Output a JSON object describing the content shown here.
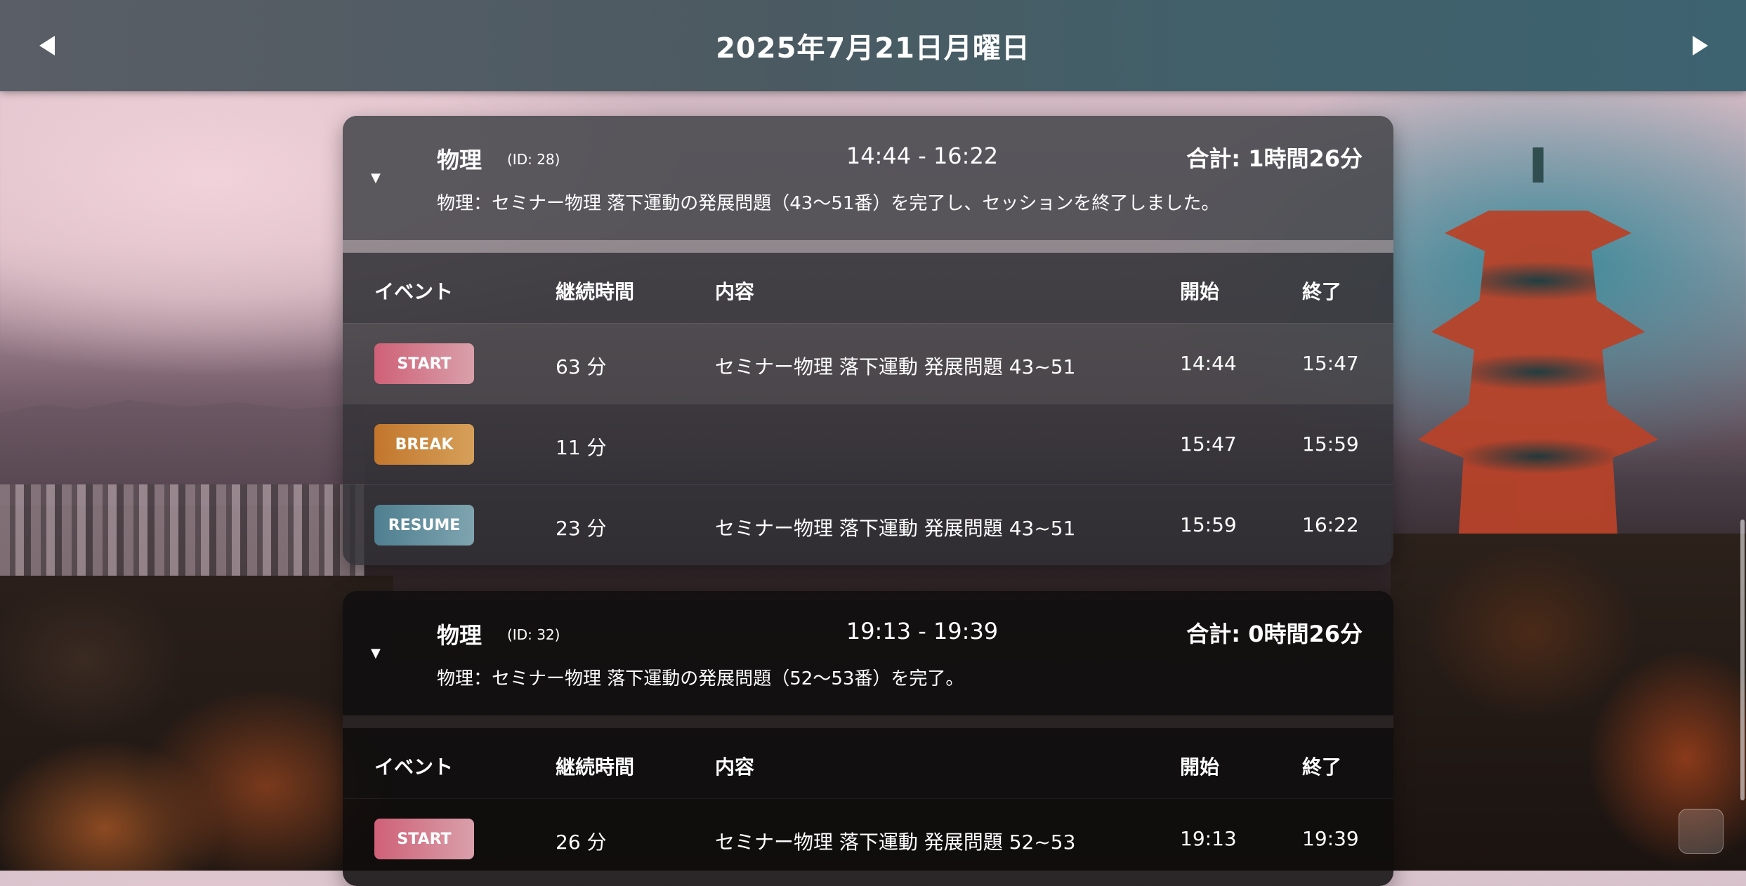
{
  "header": {
    "date_title": "2025年7月21日月曜日",
    "prev_icon": "triangle-left-icon",
    "next_icon": "triangle-right-icon"
  },
  "table_headers": {
    "event": "イベント",
    "duration": "継続時間",
    "content": "内容",
    "start": "開始",
    "end": "終了"
  },
  "sessions": [
    {
      "subject": "物理",
      "id_label": "(ID: 28)",
      "time_range": "14:44 - 16:22",
      "total_label": "合計:",
      "total_value": "1時間26分",
      "summary": "物理：セミナー物理 落下運動の発展問題（43〜51番）を完了し、セッションを終了しました。",
      "events": [
        {
          "type": "START",
          "duration": "63 分",
          "content": "セミナー物理 落下運動 発展問題 43~51",
          "start": "14:44",
          "end": "15:47"
        },
        {
          "type": "BREAK",
          "duration": "11 分",
          "content": "",
          "start": "15:47",
          "end": "15:59"
        },
        {
          "type": "RESUME",
          "duration": "23 分",
          "content": "セミナー物理 落下運動 発展問題 43~51",
          "start": "15:59",
          "end": "16:22"
        }
      ]
    },
    {
      "subject": "物理",
      "id_label": "(ID: 32)",
      "time_range": "19:13 - 19:39",
      "total_label": "合計:",
      "total_value": "0時間26分",
      "summary": "物理：セミナー物理 落下運動の発展問題（52〜53番）を完了。",
      "events": [
        {
          "type": "START",
          "duration": "26 分",
          "content": "セミナー物理 落下運動 発展問題 52~53",
          "start": "19:13",
          "end": "19:39"
        }
      ]
    }
  ],
  "icons": {
    "collapse": "triangle-down-icon"
  },
  "colors": {
    "start_badge": "#cf6077",
    "break_badge": "#c2762c",
    "resume_badge": "#4f7f90"
  }
}
